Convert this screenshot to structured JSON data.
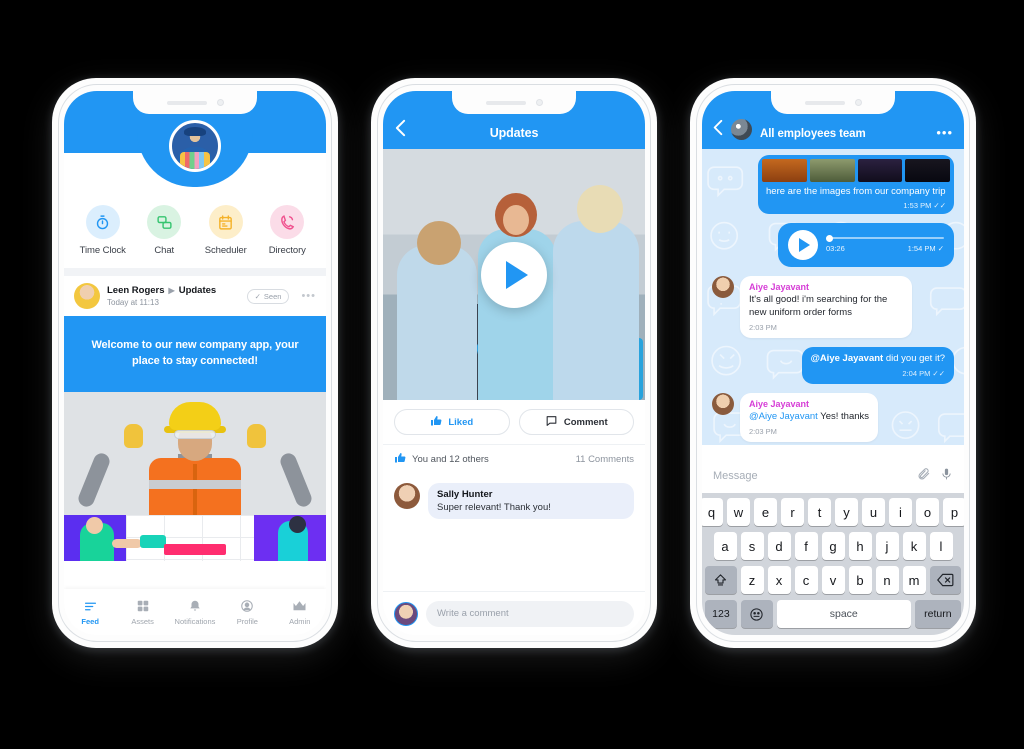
{
  "theme": {
    "brand_blue": "#2196f3",
    "chat_bg": "#d7eafb",
    "page_bg": "#000000"
  },
  "phone1": {
    "quick_actions": [
      {
        "label": "Time Clock",
        "icon": "stopwatch-icon",
        "bg": "#dbeefd",
        "fg": "#2196f3"
      },
      {
        "label": "Chat",
        "icon": "chat-bubbles-icon",
        "bg": "#d9f3e2",
        "fg": "#35c46f"
      },
      {
        "label": "Scheduler",
        "icon": "calendar-icon",
        "bg": "#fdeec9",
        "fg": "#f5b32b"
      },
      {
        "label": "Directory",
        "icon": "phone-icon",
        "bg": "#fbdce8",
        "fg": "#f0518e"
      }
    ],
    "post": {
      "author": "Leen Rogers",
      "channel": "Updates",
      "timestamp": "Today at 11:13",
      "seen_label": "Seen",
      "menu_label": "•••",
      "banner_text": "Welcome to our new company app, your place to stay connected!"
    },
    "tabs": [
      {
        "label": "Feed",
        "icon": "feed-icon",
        "active": true
      },
      {
        "label": "Assets",
        "icon": "grid-icon",
        "active": false
      },
      {
        "label": "Notifications",
        "icon": "bell-icon",
        "active": false
      },
      {
        "label": "Profile",
        "icon": "person-icon",
        "active": false
      },
      {
        "label": "Admin",
        "icon": "crown-icon",
        "active": false
      }
    ]
  },
  "phone2": {
    "header": {
      "title": "Updates",
      "back_icon": "chevron-left-icon"
    },
    "video": {
      "play_icon": "play-icon"
    },
    "actions": [
      {
        "label": "Liked",
        "icon": "thumbs-up-icon",
        "active": true
      },
      {
        "label": "Comment",
        "icon": "comment-icon",
        "active": false
      }
    ],
    "stats": {
      "likes_text": "You and 12 others",
      "comments_text": "11 Comments",
      "icon": "thumbs-up-icon"
    },
    "comment": {
      "name": "Sally Hunter",
      "text": "Super relevant! Thank you!"
    },
    "input": {
      "placeholder": "Write a comment"
    }
  },
  "phone3": {
    "header": {
      "title": "All employees team",
      "back_icon": "chevron-left-icon",
      "more_icon": "more-dots-icon",
      "avatar": "group-avatar"
    },
    "messages": [
      {
        "type": "images_out",
        "caption": "here are the images from our company trip",
        "time": "1:53 PM",
        "status": "✓✓",
        "thumbs": [
          "#b5591b",
          "#6d7a4f",
          "#1b1b26",
          "#0c0c12"
        ]
      },
      {
        "type": "voice_out",
        "duration": "03:26",
        "time": "1:54 PM",
        "status": "✓",
        "play_icon": "play-icon"
      },
      {
        "type": "in",
        "name": "Aiye Jayavant",
        "text": "It's all good! i'm searching for the new uniform order forms",
        "time": "2:03 PM"
      },
      {
        "type": "out",
        "mention": "@Aiye Jayavant",
        "text": " did you get it?",
        "time": "2:04 PM",
        "status": "✓✓"
      },
      {
        "type": "in",
        "name": "Aiye Jayavant",
        "mention": "@Aiye Jayavant",
        "text": " Yes! thanks",
        "time": "2:03 PM"
      }
    ],
    "input": {
      "placeholder": "Message",
      "attach_icon": "paperclip-icon",
      "mic_icon": "microphone-icon"
    },
    "keyboard": {
      "row1": [
        "q",
        "w",
        "e",
        "r",
        "t",
        "y",
        "u",
        "i",
        "o",
        "p"
      ],
      "row2": [
        "a",
        "s",
        "d",
        "f",
        "g",
        "h",
        "j",
        "k",
        "l"
      ],
      "row3": [
        "z",
        "x",
        "c",
        "v",
        "b",
        "n",
        "m"
      ],
      "shift_label": "⇧",
      "backspace_label": "⌫",
      "numbers_label": "123",
      "emoji_label": "☺",
      "space_label": "space",
      "return_label": "return"
    }
  }
}
